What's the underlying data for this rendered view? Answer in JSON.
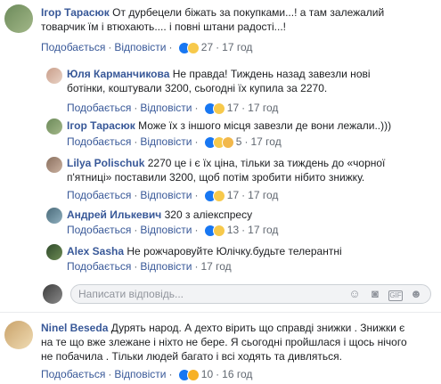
{
  "comments": [
    {
      "author": "Ігор Тарасюк",
      "text_line1": "От дурбецели біжать за покупками...! а там залежалий",
      "text_line2": "товарчик їм і втюхають.... і повні штани радості...!",
      "like": "Подобається",
      "reply": "Відповісти",
      "reacts_count": "27",
      "time": "17 год"
    },
    {
      "author": "Юля Карманчикова",
      "text_line1": "Не правда! Тиждень назад завезли нові",
      "text_line2": "ботінки, коштували 3200, сьогодні їх купила за 2270.",
      "like": "Подобається",
      "reply": "Відповісти",
      "reacts_count": "17",
      "time": "17 год"
    },
    {
      "author": "Ігор Тарасюк",
      "text_line1": "Може їх з іншого місця завезли де вони лежали..)))",
      "like": "Подобається",
      "reply": "Відповісти",
      "reacts_count": "5",
      "time": "17 год"
    },
    {
      "author": "Lilya Polischuk",
      "text_line1": "2270 це і є їх ціна, тільки за тиждень до «чорної",
      "text_line2": "п'ятниці» поставили 3200, щоб потім зробити нібито знижку.",
      "like": "Подобається",
      "reply": "Відповісти",
      "reacts_count": "17",
      "time": "17 год"
    },
    {
      "author": "Андрей Илькевич",
      "text_line1": "320 з аліекспресу",
      "like": "Подобається",
      "reply": "Відповісти",
      "reacts_count": "13",
      "time": "17 год"
    },
    {
      "author": "Alex Sasha",
      "text_line1": "Не рожчаровуйте Юлічку.будьте телерантні",
      "like": "Подобається",
      "reply": "Відповісти",
      "time": "17 год"
    },
    {
      "author": "Ninel Beseda",
      "text_line1": "Дурять народ. А дехто вірить що справді знижки . Знижки є",
      "text_line2": "на те що вже злежане і ніхто не бере. Я сьогодні пройшлася і щось нічого",
      "text_line3": "не побачила . Тільки людей багато і всі ходять та дивляться.",
      "like": "Подобається",
      "reply": "Відповісти",
      "reacts_count": "10",
      "time": "16 год"
    }
  ],
  "reply_input": {
    "placeholder": "Написати відповідь..."
  },
  "icons": [
    "emoji-icon",
    "camera-icon",
    "gif-icon",
    "sticker-icon"
  ],
  "colors": {
    "name": "#385898",
    "meta": "#606770",
    "like": "#1877f2",
    "haha": "#f7c94b"
  }
}
